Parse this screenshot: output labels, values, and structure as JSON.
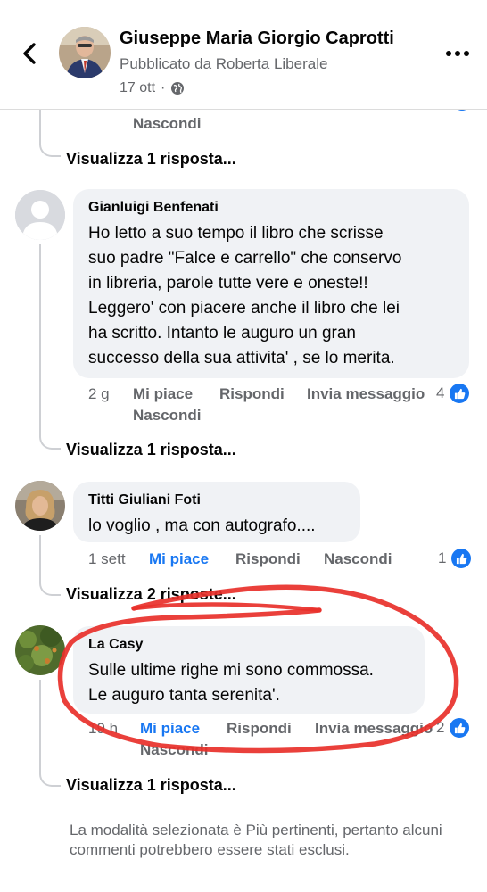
{
  "header": {
    "page_name": "Giuseppe Maria Giorgio Caprotti",
    "published_by": "Pubblicato da Roberta Liberale",
    "date": "17 ott",
    "separator": "·",
    "audience_icon": "globe-icon"
  },
  "top_partial": {
    "hide_label": "Nascondi",
    "view_replies": "Visualizza 1 risposta..."
  },
  "comments": [
    {
      "author": "Gianluigi Benfenati",
      "lines": [
        "Ho letto a suo tempo il libro che scrisse",
        "suo padre \"Falce e carrello\"   che conservo",
        "in libreria,  parole tutte vere e oneste!!",
        "Leggero' con piacere anche il libro che lei",
        "ha scritto. Intanto le auguro un gran",
        "successo della sua attivita' , se lo merita."
      ],
      "time": "2 g",
      "like": "Mi piace",
      "reply": "Rispondi",
      "message": "Invia messaggio",
      "hide": "Nascondi",
      "reaction_count": "4",
      "view_replies": "Visualizza 1 risposta...",
      "liked": false
    },
    {
      "author": "Titti Giuliani Foti",
      "lines": [
        "lo voglio , ma con autografo...."
      ],
      "time": "1 sett",
      "like": "Mi piace",
      "reply": "Rispondi",
      "hide": "Nascondi",
      "reaction_count": "1",
      "view_replies": "Visualizza 2 risposte...",
      "liked": true
    },
    {
      "author": "La Casy",
      "lines": [
        "Sulle ultime righe mi sono commossa.",
        "Le auguro tanta serenita'."
      ],
      "time": "19 h",
      "like": "Mi piace",
      "reply": "Rispondi",
      "message": "Invia messaggio",
      "hide": "Nascondi",
      "reaction_count": "2",
      "view_replies": "Visualizza 1 risposta...",
      "liked": true
    }
  ],
  "footer_note": "La modalità selezionata è Più pertinenti, pertanto alcuni commenti potrebbero essere stati esclusi.",
  "colors": {
    "accent": "#1877f2",
    "muted": "#65676b",
    "bubble": "#f0f2f5",
    "annotation_circle": "#e8302a"
  }
}
